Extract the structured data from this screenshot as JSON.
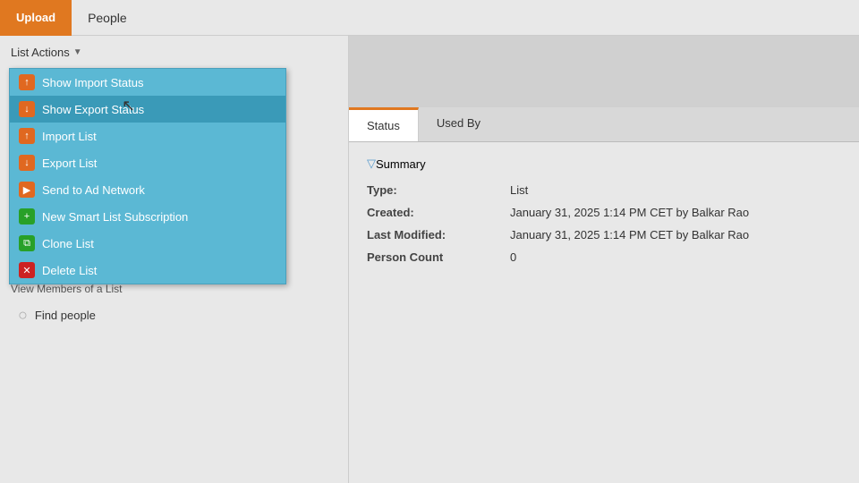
{
  "tabs": {
    "upload_label": "Upload",
    "people_label": "People"
  },
  "list_actions": {
    "label": "List Actions",
    "arrow": "▼",
    "items": [
      {
        "id": "show-import-status",
        "label": "Show Import Status",
        "icon": "↑",
        "icon_type": "import"
      },
      {
        "id": "show-export-status",
        "label": "Show Export Status",
        "icon": "↓",
        "icon_type": "export"
      },
      {
        "id": "import-list",
        "label": "Import List",
        "icon": "↑",
        "icon_type": "import-list"
      },
      {
        "id": "export-list",
        "label": "Export List",
        "icon": "↓",
        "icon_type": "export-list"
      },
      {
        "id": "send-to-ad-network",
        "label": "Send to Ad Network",
        "icon": "▶",
        "icon_type": "ad"
      },
      {
        "id": "new-smart-list-subscription",
        "label": "New Smart List Subscription",
        "icon": "+",
        "icon_type": "smart"
      },
      {
        "id": "clone-list",
        "label": "Clone List",
        "icon": "⧉",
        "icon_type": "clone"
      },
      {
        "id": "delete-list",
        "label": "Delete List",
        "icon": "✕",
        "icon_type": "delete"
      }
    ]
  },
  "left_panel": {
    "view_members_label": "View Members of a List",
    "find_people_label": "Find people"
  },
  "right_panel": {
    "tab_status_label": "Status",
    "tab_used_by_label": "Used By",
    "summary_header": "Summary",
    "fields": [
      {
        "key": "Type:",
        "value": "List"
      },
      {
        "key": "Created:",
        "value": "January 31, 2025 1:14 PM CET by Balkar Rao"
      },
      {
        "key": "Last Modified:",
        "value": "January 31, 2025 1:14 PM CET by Balkar Rao"
      },
      {
        "key": "Person Count",
        "value": "0"
      }
    ]
  },
  "colors": {
    "upload_tab_bg": "#e07820",
    "active_tab_border": "#e07820",
    "dropdown_bg": "#5bb8d4"
  }
}
